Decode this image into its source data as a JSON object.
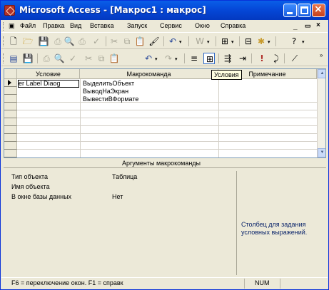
{
  "window": {
    "title": "Microsoft Access - [Макрос1 : макрос]"
  },
  "menu": [
    "Файл",
    "Правка",
    "Вид",
    "Вставка",
    "Запуск",
    "Сервис",
    "Окно",
    "Справка"
  ],
  "doc_controls": {
    "minimize": "_",
    "restore": "ð",
    "close": "×"
  },
  "tooltip": "Условия",
  "grid": {
    "headers": {
      "condition": "Условие",
      "action": "Макрокоманда",
      "comment": "Примечание"
    },
    "rows": [
      {
        "condition": "er Label Diaog",
        "action": "ВыделитьОбъект"
      },
      {
        "condition": "",
        "action": "ВыводНаЭкран"
      },
      {
        "condition": "",
        "action": "ВывестиВФормате"
      }
    ]
  },
  "arguments": {
    "title": "Аргументы макрокоманды",
    "items": [
      {
        "label": "Тип объекта",
        "value": "Таблица"
      },
      {
        "label": "Имя объекта",
        "value": ""
      },
      {
        "label": "В окне базы данных",
        "value": "Нет"
      }
    ],
    "hint": "Столбец для задания условных выражений."
  },
  "statusbar": {
    "text": "F6 = переключение окон.  F1 = справк",
    "num": "NUM"
  },
  "colors": {
    "title_bar": "#0548d8",
    "face": "#ece9d8",
    "hint_text": "#0a246a"
  }
}
